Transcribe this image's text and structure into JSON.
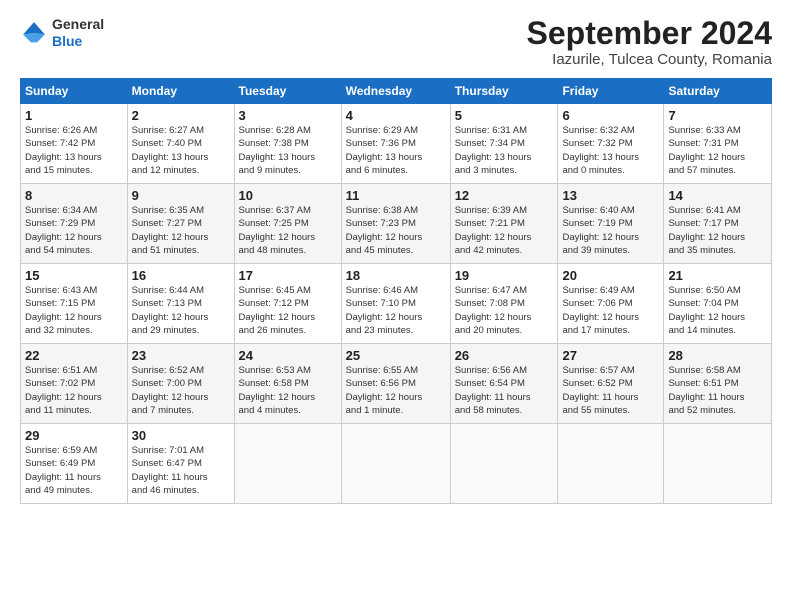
{
  "header": {
    "logo_general": "General",
    "logo_blue": "Blue",
    "title": "September 2024",
    "subtitle": "Iazurile, Tulcea County, Romania"
  },
  "calendar": {
    "weekdays": [
      "Sunday",
      "Monday",
      "Tuesday",
      "Wednesday",
      "Thursday",
      "Friday",
      "Saturday"
    ],
    "weeks": [
      [
        {
          "day": "1",
          "info": "Sunrise: 6:26 AM\nSunset: 7:42 PM\nDaylight: 13 hours\nand 15 minutes."
        },
        {
          "day": "2",
          "info": "Sunrise: 6:27 AM\nSunset: 7:40 PM\nDaylight: 13 hours\nand 12 minutes."
        },
        {
          "day": "3",
          "info": "Sunrise: 6:28 AM\nSunset: 7:38 PM\nDaylight: 13 hours\nand 9 minutes."
        },
        {
          "day": "4",
          "info": "Sunrise: 6:29 AM\nSunset: 7:36 PM\nDaylight: 13 hours\nand 6 minutes."
        },
        {
          "day": "5",
          "info": "Sunrise: 6:31 AM\nSunset: 7:34 PM\nDaylight: 13 hours\nand 3 minutes."
        },
        {
          "day": "6",
          "info": "Sunrise: 6:32 AM\nSunset: 7:32 PM\nDaylight: 13 hours\nand 0 minutes."
        },
        {
          "day": "7",
          "info": "Sunrise: 6:33 AM\nSunset: 7:31 PM\nDaylight: 12 hours\nand 57 minutes."
        }
      ],
      [
        {
          "day": "8",
          "info": "Sunrise: 6:34 AM\nSunset: 7:29 PM\nDaylight: 12 hours\nand 54 minutes."
        },
        {
          "day": "9",
          "info": "Sunrise: 6:35 AM\nSunset: 7:27 PM\nDaylight: 12 hours\nand 51 minutes."
        },
        {
          "day": "10",
          "info": "Sunrise: 6:37 AM\nSunset: 7:25 PM\nDaylight: 12 hours\nand 48 minutes."
        },
        {
          "day": "11",
          "info": "Sunrise: 6:38 AM\nSunset: 7:23 PM\nDaylight: 12 hours\nand 45 minutes."
        },
        {
          "day": "12",
          "info": "Sunrise: 6:39 AM\nSunset: 7:21 PM\nDaylight: 12 hours\nand 42 minutes."
        },
        {
          "day": "13",
          "info": "Sunrise: 6:40 AM\nSunset: 7:19 PM\nDaylight: 12 hours\nand 39 minutes."
        },
        {
          "day": "14",
          "info": "Sunrise: 6:41 AM\nSunset: 7:17 PM\nDaylight: 12 hours\nand 35 minutes."
        }
      ],
      [
        {
          "day": "15",
          "info": "Sunrise: 6:43 AM\nSunset: 7:15 PM\nDaylight: 12 hours\nand 32 minutes."
        },
        {
          "day": "16",
          "info": "Sunrise: 6:44 AM\nSunset: 7:13 PM\nDaylight: 12 hours\nand 29 minutes."
        },
        {
          "day": "17",
          "info": "Sunrise: 6:45 AM\nSunset: 7:12 PM\nDaylight: 12 hours\nand 26 minutes."
        },
        {
          "day": "18",
          "info": "Sunrise: 6:46 AM\nSunset: 7:10 PM\nDaylight: 12 hours\nand 23 minutes."
        },
        {
          "day": "19",
          "info": "Sunrise: 6:47 AM\nSunset: 7:08 PM\nDaylight: 12 hours\nand 20 minutes."
        },
        {
          "day": "20",
          "info": "Sunrise: 6:49 AM\nSunset: 7:06 PM\nDaylight: 12 hours\nand 17 minutes."
        },
        {
          "day": "21",
          "info": "Sunrise: 6:50 AM\nSunset: 7:04 PM\nDaylight: 12 hours\nand 14 minutes."
        }
      ],
      [
        {
          "day": "22",
          "info": "Sunrise: 6:51 AM\nSunset: 7:02 PM\nDaylight: 12 hours\nand 11 minutes."
        },
        {
          "day": "23",
          "info": "Sunrise: 6:52 AM\nSunset: 7:00 PM\nDaylight: 12 hours\nand 7 minutes."
        },
        {
          "day": "24",
          "info": "Sunrise: 6:53 AM\nSunset: 6:58 PM\nDaylight: 12 hours\nand 4 minutes."
        },
        {
          "day": "25",
          "info": "Sunrise: 6:55 AM\nSunset: 6:56 PM\nDaylight: 12 hours\nand 1 minute."
        },
        {
          "day": "26",
          "info": "Sunrise: 6:56 AM\nSunset: 6:54 PM\nDaylight: 11 hours\nand 58 minutes."
        },
        {
          "day": "27",
          "info": "Sunrise: 6:57 AM\nSunset: 6:52 PM\nDaylight: 11 hours\nand 55 minutes."
        },
        {
          "day": "28",
          "info": "Sunrise: 6:58 AM\nSunset: 6:51 PM\nDaylight: 11 hours\nand 52 minutes."
        }
      ],
      [
        {
          "day": "29",
          "info": "Sunrise: 6:59 AM\nSunset: 6:49 PM\nDaylight: 11 hours\nand 49 minutes."
        },
        {
          "day": "30",
          "info": "Sunrise: 7:01 AM\nSunset: 6:47 PM\nDaylight: 11 hours\nand 46 minutes."
        },
        {
          "day": "",
          "info": ""
        },
        {
          "day": "",
          "info": ""
        },
        {
          "day": "",
          "info": ""
        },
        {
          "day": "",
          "info": ""
        },
        {
          "day": "",
          "info": ""
        }
      ]
    ]
  }
}
